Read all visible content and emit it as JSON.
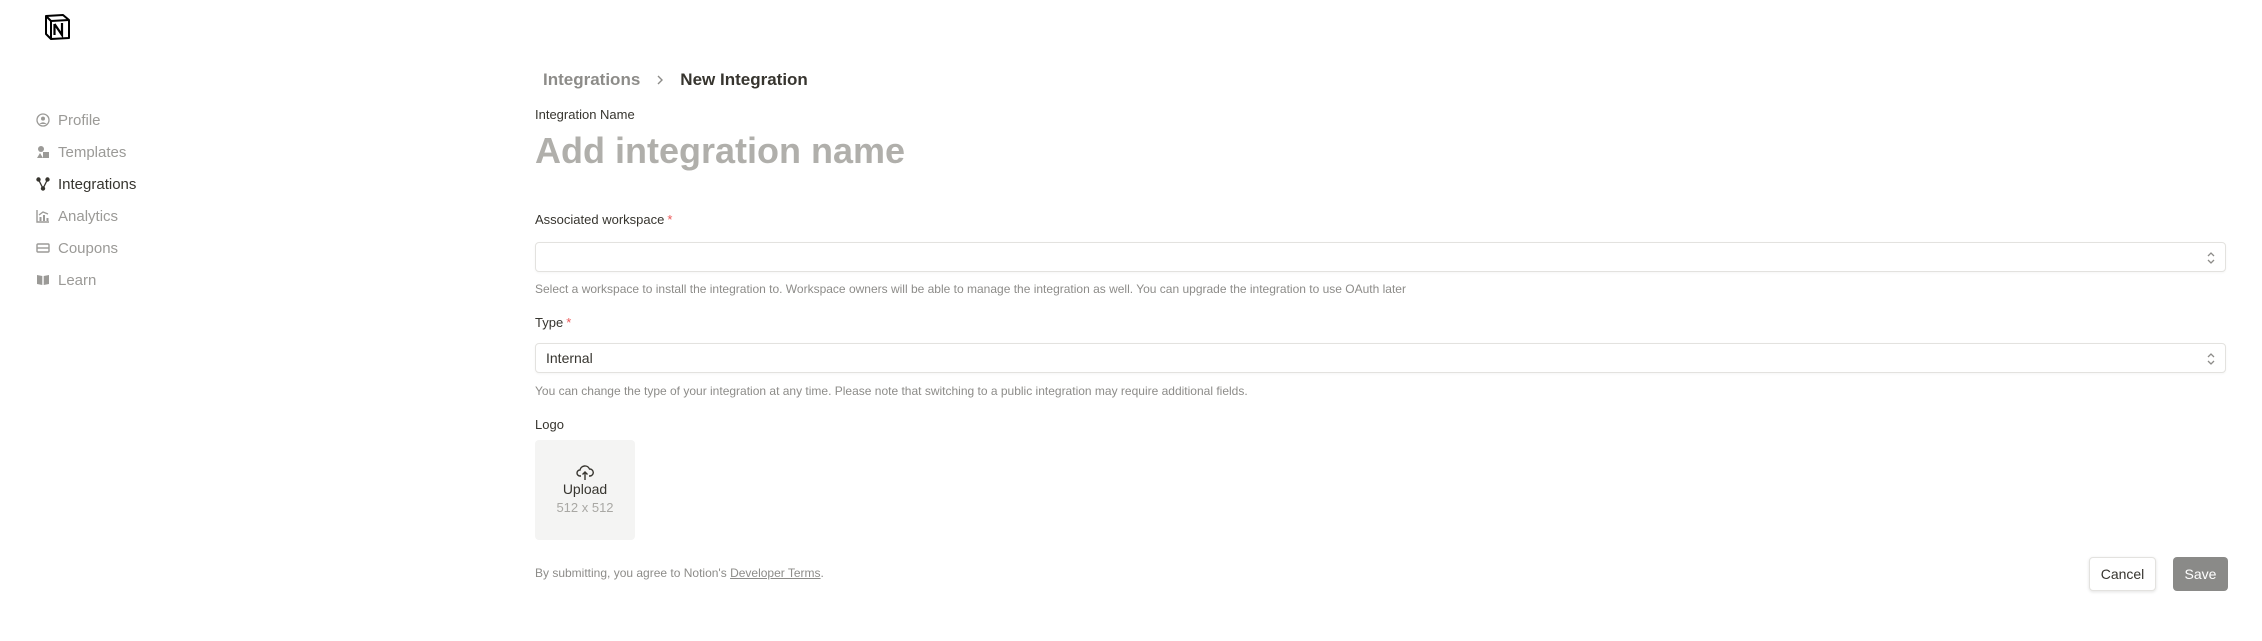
{
  "sidebar": {
    "items": [
      {
        "label": "Profile",
        "icon": "user-circle-icon",
        "active": false
      },
      {
        "label": "Templates",
        "icon": "shapes-icon",
        "active": false
      },
      {
        "label": "Integrations",
        "icon": "integrations-icon",
        "active": true
      },
      {
        "label": "Analytics",
        "icon": "analytics-icon",
        "active": false
      },
      {
        "label": "Coupons",
        "icon": "coupon-icon",
        "active": false
      },
      {
        "label": "Learn",
        "icon": "book-icon",
        "active": false
      }
    ]
  },
  "breadcrumb": {
    "parent": "Integrations",
    "current": "New Integration"
  },
  "form": {
    "name_label": "Integration Name",
    "name_placeholder": "Add integration name",
    "name_value": "",
    "workspace_label": "Associated workspace",
    "workspace_value": "",
    "workspace_hint": "Select a workspace to install the integration to. Workspace owners will be able to manage the integration as well. You can upgrade the integration to use OAuth later",
    "type_label": "Type",
    "type_value": "Internal",
    "type_hint": "You can change the type of your integration at any time. Please note that switching to a public integration may require additional fields.",
    "required_mark": "*",
    "logo_label": "Logo",
    "upload_label": "Upload",
    "upload_size": "512 x 512"
  },
  "footer": {
    "terms_prefix": "By submitting, you agree to Notion's ",
    "terms_link": "Developer Terms",
    "terms_suffix": ".",
    "cancel_label": "Cancel",
    "save_label": "Save"
  },
  "colors": {
    "required": "#eb5757",
    "save_button_bg": "#8a8a88",
    "muted_text": "#9b9a97"
  }
}
